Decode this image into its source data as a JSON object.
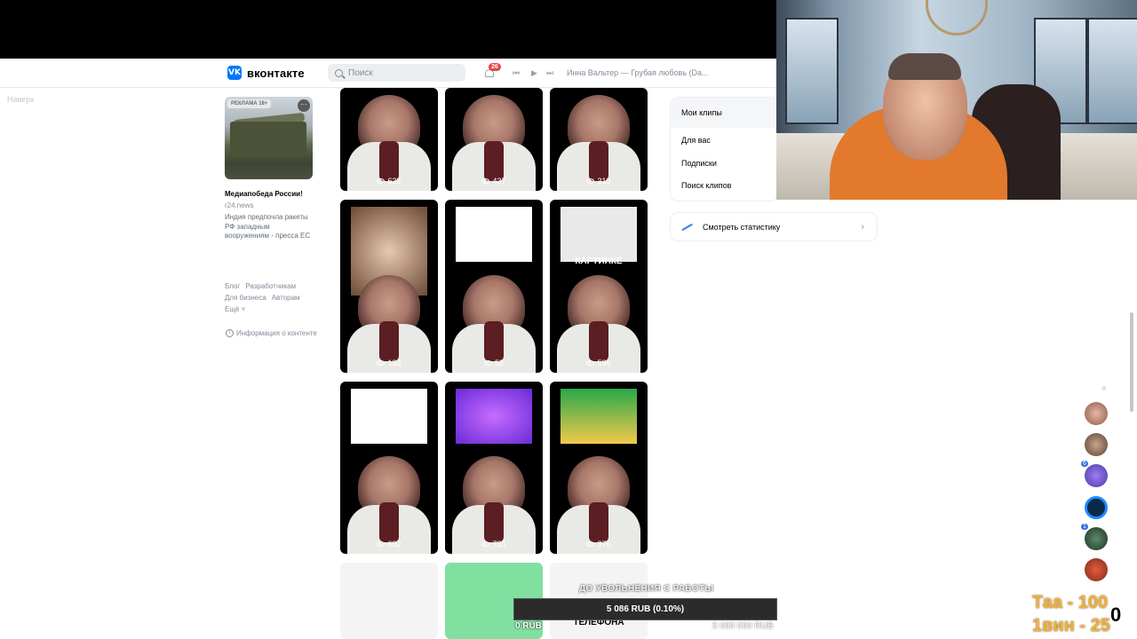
{
  "header": {
    "logo_text": "вконтакте",
    "search_placeholder": "Поиск",
    "notifications_count": "26",
    "prev_symbol": "⏮",
    "play_symbol": "▶",
    "next_symbol": "⏭",
    "track_title": "Инна Вальтер — Грубая любовь (Da..."
  },
  "sidebar": {
    "back_to_top": "Наверх"
  },
  "ad": {
    "label": "РЕКЛАМА 18+",
    "more_symbol": "···",
    "title": "Медиапобеда России!",
    "source": "r24.news",
    "description": "Индия предпочла ракеты РФ западным вооружениям - пресса ЕС"
  },
  "footer_links": {
    "blog": "Блог",
    "developers": "Разработчикам",
    "business": "Для бизнеса",
    "authors": "Авторам",
    "more": "Ещё ˅",
    "content_info": "Информация о контенте"
  },
  "clips": [
    {
      "views": "635"
    },
    {
      "views": "437"
    },
    {
      "views": "319"
    },
    {
      "views": "133"
    },
    {
      "views": "52"
    },
    {
      "views": "596",
      "caption": "КАРТИНКЕ"
    },
    {
      "views": "692"
    },
    {
      "views": "785"
    },
    {
      "views": "375"
    },
    {
      "views": ""
    },
    {
      "views": ""
    },
    {
      "views": "",
      "caption": "ТЕЛЕФОНА"
    }
  ],
  "right_menu": {
    "my_clips": "Мои клипы",
    "for_you": "Для вас",
    "subscriptions": "Подписки",
    "search_clips": "Поиск клипов",
    "statistics": "Смотреть статистику",
    "chevron": "›"
  },
  "right_rail": {
    "collapse": "«",
    "badge1": "6",
    "badge2": "1"
  },
  "overlay": {
    "goal_title": "ДО УВОЛЬНЕНИЯ С РАБОТЫ",
    "progress_text": "5 086 RUB (0.10%)",
    "progress_fraction": 0.001,
    "min_label": "0 RUB",
    "max_label": "5 000 000 RUB",
    "tag1": "Таа - 100",
    "tag2": "1вин - 25",
    "zero": "0"
  },
  "colors": {
    "vk_blue": "#0077ff",
    "badge_red": "#e64646",
    "overlay_gold": "#f0b13a",
    "webcam_shirt": "#e2792d"
  }
}
